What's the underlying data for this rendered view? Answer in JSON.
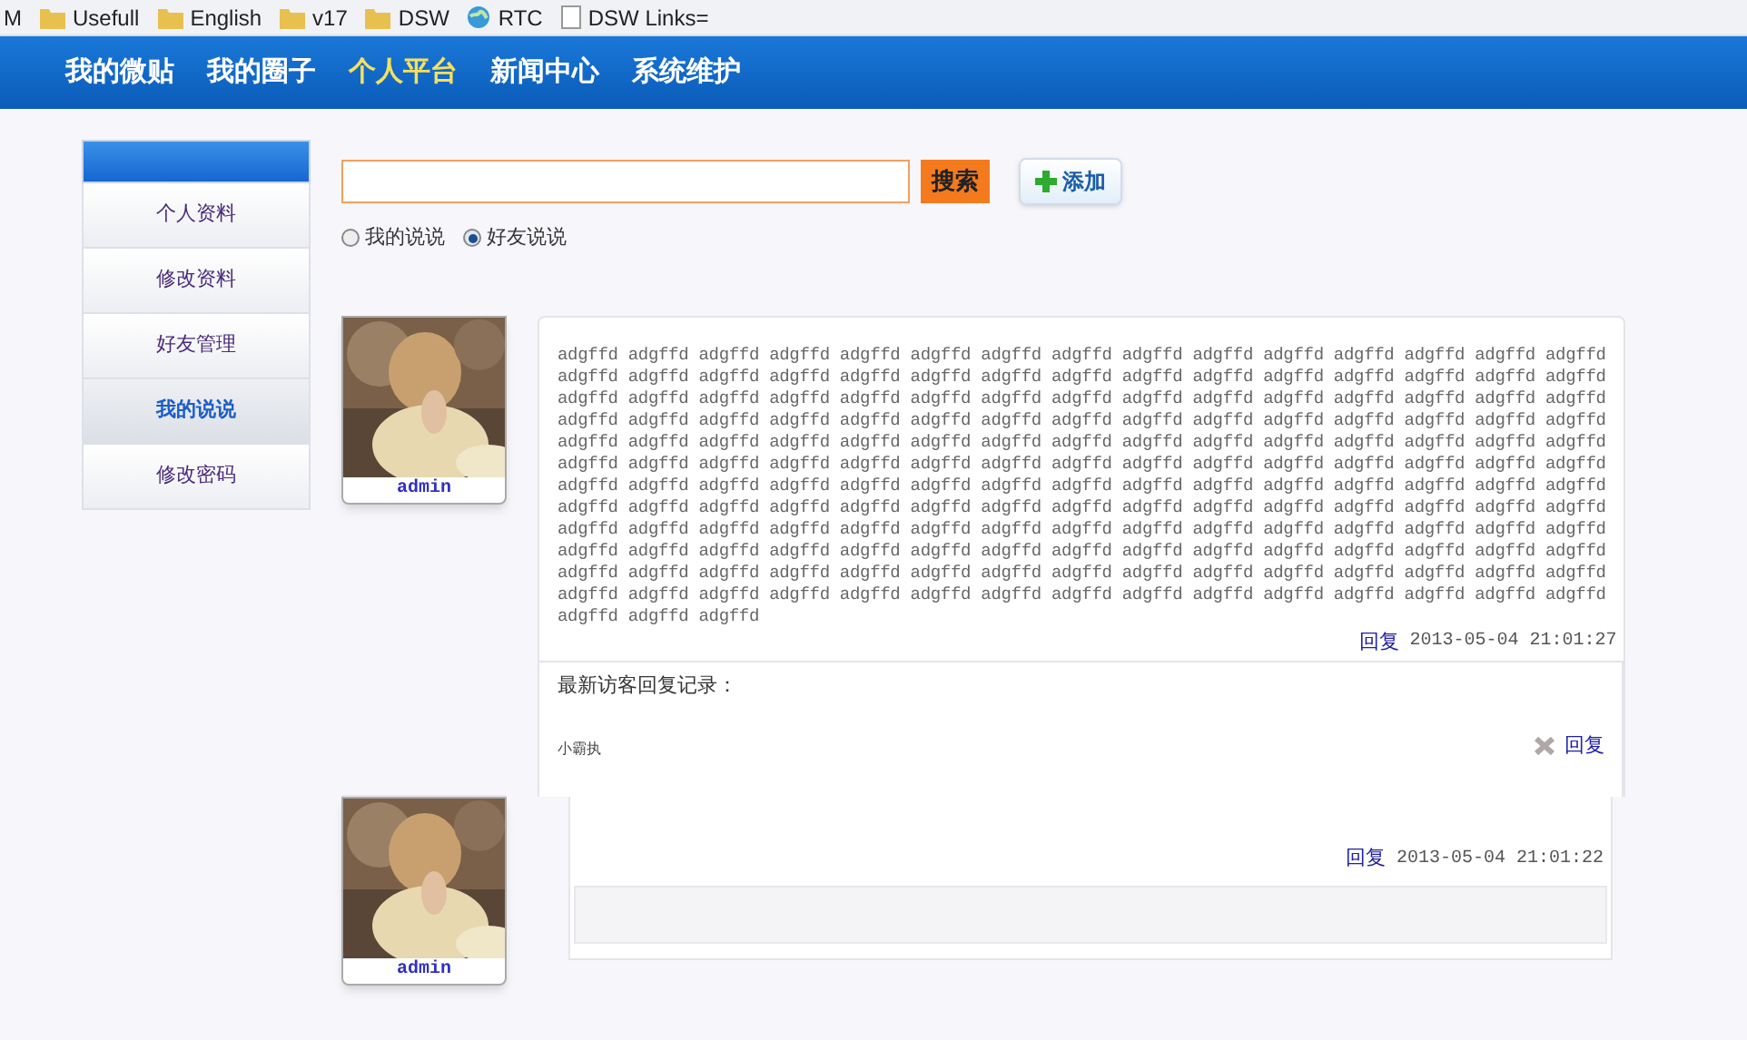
{
  "bookmarks_bar": [
    {
      "label": "M",
      "kind": "none"
    },
    {
      "label": "Usefull",
      "kind": "folder"
    },
    {
      "label": "English",
      "kind": "folder"
    },
    {
      "label": "v17",
      "kind": "folder"
    },
    {
      "label": "DSW",
      "kind": "folder"
    },
    {
      "label": "RTC",
      "kind": "globe"
    },
    {
      "label": "DSW Links=",
      "kind": "page"
    }
  ],
  "nav": [
    {
      "label": "我的微贴",
      "selected": false
    },
    {
      "label": "我的圈子",
      "selected": false
    },
    {
      "label": "个人平台",
      "selected": true
    },
    {
      "label": "新闻中心",
      "selected": false
    },
    {
      "label": "系统维护",
      "selected": false
    }
  ],
  "sidebar": {
    "items": [
      {
        "label": "个人资料",
        "selected": false
      },
      {
        "label": "修改资料",
        "selected": false
      },
      {
        "label": "好友管理",
        "selected": false
      },
      {
        "label": "我的说说",
        "selected": true
      },
      {
        "label": "修改密码",
        "selected": false
      }
    ]
  },
  "search": {
    "button": "搜索",
    "add_button": "添加"
  },
  "filter": [
    {
      "label": "我的说说",
      "selected": false
    },
    {
      "label": "好友说说",
      "selected": true
    }
  ],
  "posts": [
    {
      "author": "admin",
      "lines": [
        "adgffd adgffd adgffd adgffd adgffd adgffd adgffd adgffd adgffd adgffd adgffd adgffd adgffd adgffd adgffd",
        "adgffd adgffd adgffd adgffd adgffd adgffd adgffd adgffd adgffd adgffd adgffd adgffd adgffd adgffd adgffd",
        "adgffd adgffd adgffd adgffd adgffd adgffd adgffd adgffd adgffd adgffd adgffd adgffd adgffd adgffd adgffd",
        "adgffd adgffd adgffd adgffd adgffd adgffd adgffd adgffd adgffd adgffd adgffd adgffd adgffd adgffd adgffd",
        "adgffd adgffd adgffd adgffd adgffd adgffd adgffd adgffd adgffd adgffd adgffd adgffd adgffd adgffd adgffd",
        "adgffd adgffd adgffd adgffd adgffd adgffd adgffd adgffd adgffd adgffd adgffd adgffd adgffd adgffd adgffd",
        "adgffd adgffd adgffd adgffd adgffd adgffd adgffd adgffd adgffd adgffd adgffd adgffd adgffd adgffd adgffd",
        "adgffd adgffd adgffd adgffd adgffd adgffd adgffd adgffd adgffd adgffd adgffd adgffd adgffd adgffd adgffd",
        "adgffd adgffd adgffd adgffd adgffd adgffd adgffd adgffd adgffd adgffd adgffd adgffd adgffd adgffd adgffd",
        "adgffd adgffd adgffd adgffd adgffd adgffd adgffd adgffd adgffd adgffd adgffd adgffd adgffd adgffd adgffd",
        "adgffd adgffd adgffd adgffd adgffd adgffd adgffd adgffd adgffd adgffd adgffd adgffd adgffd adgffd adgffd",
        "adgffd adgffd adgffd adgffd adgffd adgffd adgffd adgffd adgffd adgffd adgffd adgffd adgffd adgffd adgffd",
        "adgffd adgffd adgffd"
      ],
      "reply_link": "回复",
      "time": "2013-05-04 21:01:27",
      "replies_title": "最新访客回复记录：",
      "replies": [
        {
          "author": "小霸执",
          "reply_link": "回复"
        }
      ]
    },
    {
      "author": "admin",
      "reply_link": "回复",
      "time": "2013-05-04 21:01:22"
    }
  ]
}
